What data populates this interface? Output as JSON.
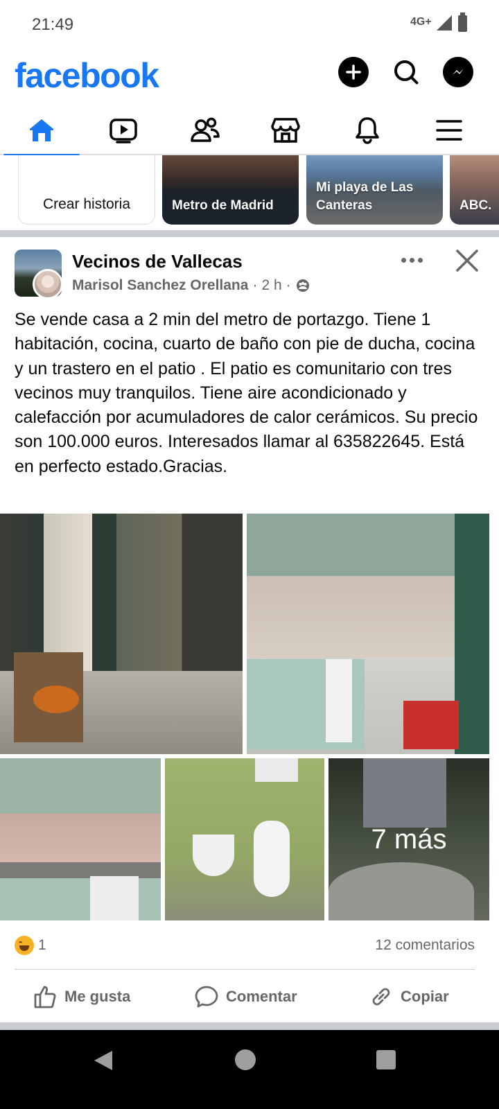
{
  "status_bar": {
    "time": "21:49",
    "network": "4G+"
  },
  "header": {
    "logo": "facebook",
    "create_icon": "plus-circle-icon",
    "search_icon": "search-icon",
    "messenger_icon": "messenger-icon"
  },
  "nav": {
    "tabs": [
      {
        "name": "home",
        "icon": "home-icon",
        "active": true
      },
      {
        "name": "video",
        "icon": "video-icon",
        "active": false
      },
      {
        "name": "friends",
        "icon": "friends-icon",
        "active": false
      },
      {
        "name": "marketplace",
        "icon": "marketplace-icon",
        "active": false
      },
      {
        "name": "notifications",
        "icon": "bell-icon",
        "active": false
      },
      {
        "name": "menu",
        "icon": "menu-icon",
        "active": false
      }
    ],
    "accent": "#1877F2"
  },
  "stories": [
    {
      "label": "Crear historia"
    },
    {
      "label": "Metro de Madrid"
    },
    {
      "label": "Mi playa de Las Canteras"
    },
    {
      "label": "ABC."
    }
  ],
  "post": {
    "group_name": "Vecinos de Vallecas",
    "author": "Marisol Sanchez Orellana",
    "time": "2 h",
    "separator": "·",
    "audience_icon": "group-audience-icon",
    "text": "Se vende casa a 2 min del metro de portazgo. Tiene 1 habitación, cocina, cuarto de baño con pie de ducha, cocina y un trastero en el patio . El patio es comunitario con tres vecinos muy tranquilos. Tiene aire acondicionado y calefacción por acumuladores de calor cerámicos. Su precio son 100.000 euros. Interesados llamar al 635822645. Está en perfecto estado.Gracias.",
    "more_photos": "7 más",
    "reaction_count": "1",
    "comments": "12 comentarios",
    "actions": {
      "like": "Me gusta",
      "comment": "Comentar",
      "copy": "Copiar"
    }
  }
}
